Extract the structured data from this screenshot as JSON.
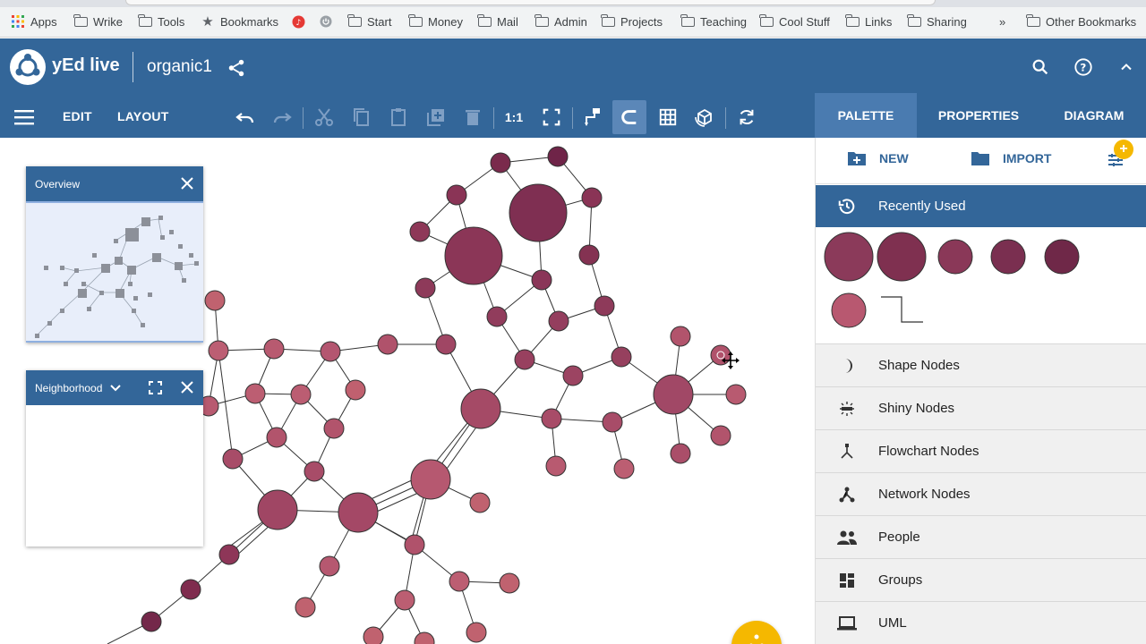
{
  "bookmarks": [
    {
      "label": "Apps",
      "icon": "apps-grid-icon"
    },
    {
      "label": "Wrike",
      "icon": "folder-icon"
    },
    {
      "label": "Tools",
      "icon": "folder-icon"
    },
    {
      "label": "Bookmarks",
      "icon": "star-icon"
    },
    {
      "label": "",
      "icon": "music-red-icon"
    },
    {
      "label": "",
      "icon": "power-icon"
    },
    {
      "label": "Start",
      "icon": "folder-icon"
    },
    {
      "label": "Money",
      "icon": "folder-icon"
    },
    {
      "label": "Mail",
      "icon": "folder-icon"
    },
    {
      "label": "Admin",
      "icon": "folder-icon"
    },
    {
      "label": "Projects",
      "icon": "folder-icon"
    },
    {
      "label": "Teaching",
      "icon": "folder-icon"
    },
    {
      "label": "Cool Stuff",
      "icon": "folder-icon"
    },
    {
      "label": "Links",
      "icon": "folder-icon"
    },
    {
      "label": "Sharing",
      "icon": "folder-icon"
    }
  ],
  "bookmarks_overflow": "»",
  "other_bookmarks": "Other Bookmarks",
  "header": {
    "app_name": "yEd live",
    "doc_name": "organic1"
  },
  "menu": {
    "edit": "EDIT",
    "layout": "LAYOUT",
    "zoom_one_to_one": "1:1"
  },
  "side_tabs": [
    "PALETTE",
    "PROPERTIES",
    "DIAGRAM"
  ],
  "palette_actions": {
    "new": "NEW",
    "import": "IMPORT",
    "badge": "+"
  },
  "panels": {
    "overview": "Overview",
    "neighborhood": "Neighborhood"
  },
  "recently_used": {
    "title": "Recently Used",
    "swatches": [
      "#8b3a5a",
      "#7f3050",
      "#8a3858",
      "#7a2f50",
      "#6f2848",
      "#b85870"
    ]
  },
  "categories": [
    {
      "label": "Shape Nodes",
      "icon": "shape-moon-icon"
    },
    {
      "label": "Shiny Nodes",
      "icon": "shiny-icon"
    },
    {
      "label": "Flowchart Nodes",
      "icon": "flowchart-icon"
    },
    {
      "label": "Network Nodes",
      "icon": "network-icon"
    },
    {
      "label": "People",
      "icon": "people-icon"
    },
    {
      "label": "Groups",
      "icon": "groups-icon"
    },
    {
      "label": "UML",
      "icon": "laptop-icon"
    }
  ],
  "colors": {
    "brand": "#336699",
    "node_light": "#c0606e",
    "node_mid": "#a84a62",
    "node_dark": "#7a2a4c",
    "fab": "#f5b800"
  }
}
